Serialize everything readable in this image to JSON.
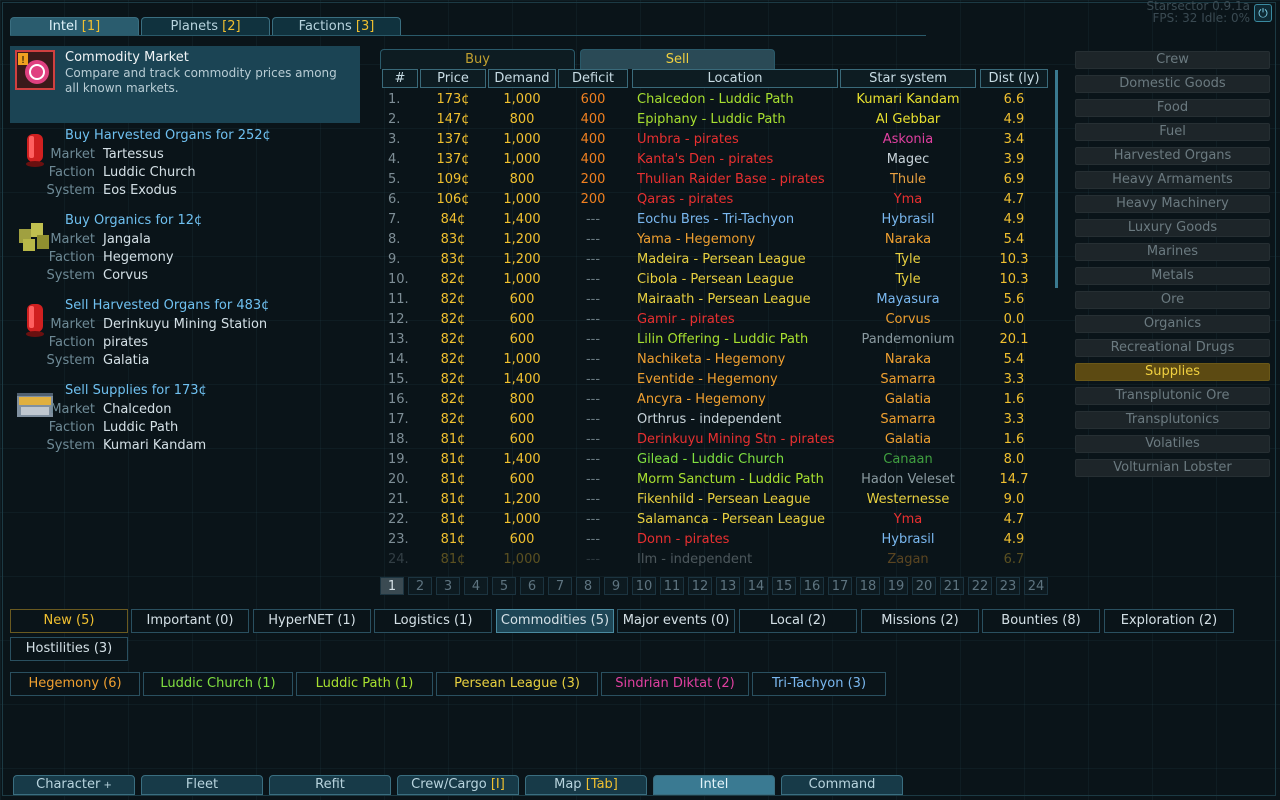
{
  "status": {
    "line1": "Starsector 0.9.1a",
    "line2": "FPS: 32 Idle: 0%"
  },
  "top_tabs": [
    {
      "label": "Intel",
      "hotkey": "1"
    },
    {
      "label": "Planets",
      "hotkey": "2"
    },
    {
      "label": "Factions",
      "hotkey": "3"
    }
  ],
  "featured": {
    "title": "Commodity Market",
    "desc": "Compare and track commodity prices among all known markets."
  },
  "intel_items": [
    {
      "title": "Buy Harvested Organs for 252¢",
      "market_label": "Market",
      "market": "Tartessus",
      "faction_label": "Faction",
      "faction": "Luddic Church",
      "system_label": "System",
      "system": "Eos Exodus",
      "icon": "organs-icon"
    },
    {
      "title": "Buy Organics for 12¢",
      "market_label": "Market",
      "market": "Jangala",
      "faction_label": "Faction",
      "faction": "Hegemony",
      "system_label": "System",
      "system": "Corvus",
      "icon": "organics-icon"
    },
    {
      "title": "Sell Harvested Organs for 483¢",
      "market_label": "Market",
      "market": "Derinkuyu Mining Station",
      "faction_label": "Faction",
      "faction": "pirates",
      "system_label": "System",
      "system": "Galatia",
      "icon": "organs-icon"
    },
    {
      "title": "Sell Supplies for 173¢",
      "market_label": "Market",
      "market": "Chalcedon",
      "faction_label": "Faction",
      "faction": "Luddic Path",
      "system_label": "System",
      "system": "Kumari Kandam",
      "icon": "supplies-icon"
    }
  ],
  "market": {
    "buy_tab": "Buy",
    "sell_tab": "Sell",
    "columns": [
      "#",
      "Price",
      "Demand",
      "Deficit",
      "Location",
      "Star system",
      "Dist (ly)"
    ],
    "rows": [
      {
        "n": "1.",
        "price": "173¢",
        "demand": "1,000",
        "deficit": "600",
        "location": "Chalcedon - Luddic Path",
        "system": "Kumari Kandam",
        "dist": "6.6",
        "lc": "#a8e030",
        "sc": "#e8e030"
      },
      {
        "n": "2.",
        "price": "147¢",
        "demand": "800",
        "deficit": "400",
        "location": "Epiphany - Luddic Path",
        "system": "Al Gebbar",
        "dist": "4.9",
        "lc": "#a8e030",
        "sc": "#e8e030"
      },
      {
        "n": "3.",
        "price": "137¢",
        "demand": "1,000",
        "deficit": "400",
        "location": "Umbra - pirates",
        "system": "Askonia",
        "dist": "3.4",
        "lc": "#e83030",
        "sc": "#e040a0"
      },
      {
        "n": "4.",
        "price": "137¢",
        "demand": "1,000",
        "deficit": "400",
        "location": "Kanta's Den - pirates",
        "system": "Magec",
        "dist": "3.9",
        "lc": "#e83030",
        "sc": "#c8d4da"
      },
      {
        "n": "5.",
        "price": "109¢",
        "demand": "800",
        "deficit": "200",
        "location": "Thulian Raider Base - pirates",
        "system": "Thule",
        "dist": "6.9",
        "lc": "#e83030",
        "sc": "#e8a040"
      },
      {
        "n": "6.",
        "price": "106¢",
        "demand": "1,000",
        "deficit": "200",
        "location": "Qaras - pirates",
        "system": "Yma",
        "dist": "4.7",
        "lc": "#e83030",
        "sc": "#e83030"
      },
      {
        "n": "7.",
        "price": "84¢",
        "demand": "1,400",
        "deficit": "---",
        "location": "Eochu Bres - Tri-Tachyon",
        "system": "Hybrasil",
        "dist": "4.9",
        "lc": "#7ab8f0",
        "sc": "#7ab8f0"
      },
      {
        "n": "8.",
        "price": "83¢",
        "demand": "1,200",
        "deficit": "---",
        "location": "Yama - Hegemony",
        "system": "Naraka",
        "dist": "5.4",
        "lc": "#f0a030",
        "sc": "#f0a030"
      },
      {
        "n": "9.",
        "price": "83¢",
        "demand": "1,200",
        "deficit": "---",
        "location": "Madeira - Persean League",
        "system": "Tyle",
        "dist": "10.3",
        "lc": "#e8d040",
        "sc": "#e8d040"
      },
      {
        "n": "10.",
        "price": "82¢",
        "demand": "1,000",
        "deficit": "---",
        "location": "Cibola - Persean League",
        "system": "Tyle",
        "dist": "10.3",
        "lc": "#e8d040",
        "sc": "#e8d040"
      },
      {
        "n": "11.",
        "price": "82¢",
        "demand": "600",
        "deficit": "---",
        "location": "Mairaath - Persean League",
        "system": "Mayasura",
        "dist": "5.6",
        "lc": "#e8d040",
        "sc": "#7ab8f0"
      },
      {
        "n": "12.",
        "price": "82¢",
        "demand": "600",
        "deficit": "---",
        "location": "Gamir - pirates",
        "system": "Corvus",
        "dist": "0.0",
        "lc": "#e83030",
        "sc": "#f0a030"
      },
      {
        "n": "13.",
        "price": "82¢",
        "demand": "600",
        "deficit": "---",
        "location": "Lilin Offering - Luddic Path",
        "system": "Pandemonium",
        "dist": "20.1",
        "lc": "#a8e030",
        "sc": "#8a9aa0"
      },
      {
        "n": "14.",
        "price": "82¢",
        "demand": "1,000",
        "deficit": "---",
        "location": "Nachiketa - Hegemony",
        "system": "Naraka",
        "dist": "5.4",
        "lc": "#f0a030",
        "sc": "#f0a030"
      },
      {
        "n": "15.",
        "price": "82¢",
        "demand": "1,400",
        "deficit": "---",
        "location": "Eventide - Hegemony",
        "system": "Samarra",
        "dist": "3.3",
        "lc": "#f0a030",
        "sc": "#f0a030"
      },
      {
        "n": "16.",
        "price": "82¢",
        "demand": "800",
        "deficit": "---",
        "location": "Ancyra - Hegemony",
        "system": "Galatia",
        "dist": "1.6",
        "lc": "#f0a030",
        "sc": "#f0a030"
      },
      {
        "n": "17.",
        "price": "82¢",
        "demand": "600",
        "deficit": "---",
        "location": "Orthrus - independent",
        "system": "Samarra",
        "dist": "3.3",
        "lc": "#c8d4da",
        "sc": "#f0a030"
      },
      {
        "n": "18.",
        "price": "81¢",
        "demand": "600",
        "deficit": "---",
        "location": "Derinkuyu Mining Stn - pirates",
        "system": "Galatia",
        "dist": "1.6",
        "lc": "#e83030",
        "sc": "#f0a030"
      },
      {
        "n": "19.",
        "price": "81¢",
        "demand": "1,400",
        "deficit": "---",
        "location": "Gilead - Luddic Church",
        "system": "Canaan",
        "dist": "8.0",
        "lc": "#80e040",
        "sc": "#40a040"
      },
      {
        "n": "20.",
        "price": "81¢",
        "demand": "600",
        "deficit": "---",
        "location": "Morm Sanctum - Luddic Path",
        "system": "Hadon Veleset",
        "dist": "14.7",
        "lc": "#a8e030",
        "sc": "#8a9aa0"
      },
      {
        "n": "21.",
        "price": "81¢",
        "demand": "1,200",
        "deficit": "---",
        "location": "Fikenhild - Persean League",
        "system": "Westernesse",
        "dist": "9.0",
        "lc": "#e8d040",
        "sc": "#e8d040"
      },
      {
        "n": "22.",
        "price": "81¢",
        "demand": "1,000",
        "deficit": "---",
        "location": "Salamanca - Persean League",
        "system": "Yma",
        "dist": "4.7",
        "lc": "#e8d040",
        "sc": "#e83030"
      },
      {
        "n": "23.",
        "price": "81¢",
        "demand": "600",
        "deficit": "---",
        "location": "Donn - pirates",
        "system": "Hybrasil",
        "dist": "4.9",
        "lc": "#e83030",
        "sc": "#7ab8f0"
      },
      {
        "n": "24.",
        "price": "81¢",
        "demand": "1,000",
        "deficit": "---",
        "location": "Ilm - independent",
        "system": "Zagan",
        "dist": "6.7",
        "lc": "#c8d4da",
        "sc": "#f0a030"
      }
    ],
    "pages": [
      "1",
      "2",
      "3",
      "4",
      "5",
      "6",
      "7",
      "8",
      "9",
      "10",
      "11",
      "12",
      "13",
      "14",
      "15",
      "16",
      "17",
      "18",
      "19",
      "20",
      "21",
      "22",
      "23",
      "24"
    ],
    "active_page": "1"
  },
  "commodities": [
    "Crew",
    "Domestic Goods",
    "Food",
    "Fuel",
    "Harvested Organs",
    "Heavy Armaments",
    "Heavy Machinery",
    "Luxury Goods",
    "Marines",
    "Metals",
    "Ore",
    "Organics",
    "Recreational Drugs",
    "Supplies",
    "Transplutonic Ore",
    "Transplutonics",
    "Volatiles",
    "Volturnian Lobster"
  ],
  "selected_commodity": "Supplies",
  "filters": [
    {
      "label": "New (5)",
      "color": "#f0c030"
    },
    {
      "label": "Important (0)",
      "color": "#d4e0e6"
    },
    {
      "label": "HyperNET (1)",
      "color": "#d4e0e6"
    },
    {
      "label": "Logistics (1)",
      "color": "#d4e0e6"
    },
    {
      "label": "Commodities (5)",
      "color": "#d4e0e6"
    },
    {
      "label": "Major events (0)",
      "color": "#d4e0e6"
    },
    {
      "label": "Local (2)",
      "color": "#d4e0e6"
    },
    {
      "label": "Missions (2)",
      "color": "#d4e0e6"
    },
    {
      "label": "Bounties (8)",
      "color": "#d4e0e6"
    },
    {
      "label": "Exploration (2)",
      "color": "#d4e0e6"
    },
    {
      "label": "Hostilities (3)",
      "color": "#d4e0e6"
    }
  ],
  "faction_filters": [
    {
      "label": "Hegemony (6)",
      "color": "#f0a030"
    },
    {
      "label": "Luddic Church (1)",
      "color": "#80e040"
    },
    {
      "label": "Luddic Path (1)",
      "color": "#a8e030"
    },
    {
      "label": "Persean League (3)",
      "color": "#e8d040"
    },
    {
      "label": "Sindrian Diktat (2)",
      "color": "#e040a0"
    },
    {
      "label": "Tri-Tachyon (3)",
      "color": "#7ab8f0"
    }
  ],
  "nav": [
    {
      "label": "Character",
      "hotkey": "C",
      "suffix": " +"
    },
    {
      "label": "Fleet",
      "hotkey": "F",
      "suffix": ""
    },
    {
      "label": "Refit",
      "hotkey": "R",
      "suffix": ""
    },
    {
      "label": "Crew/Cargo",
      "hotkey": "I",
      "suffix": ""
    },
    {
      "label": "Map",
      "hotkey": "Tab",
      "suffix": ""
    },
    {
      "label": "Intel",
      "hotkey": "e",
      "suffix": ""
    },
    {
      "label": "Command",
      "hotkey": "D",
      "suffix": ""
    }
  ]
}
